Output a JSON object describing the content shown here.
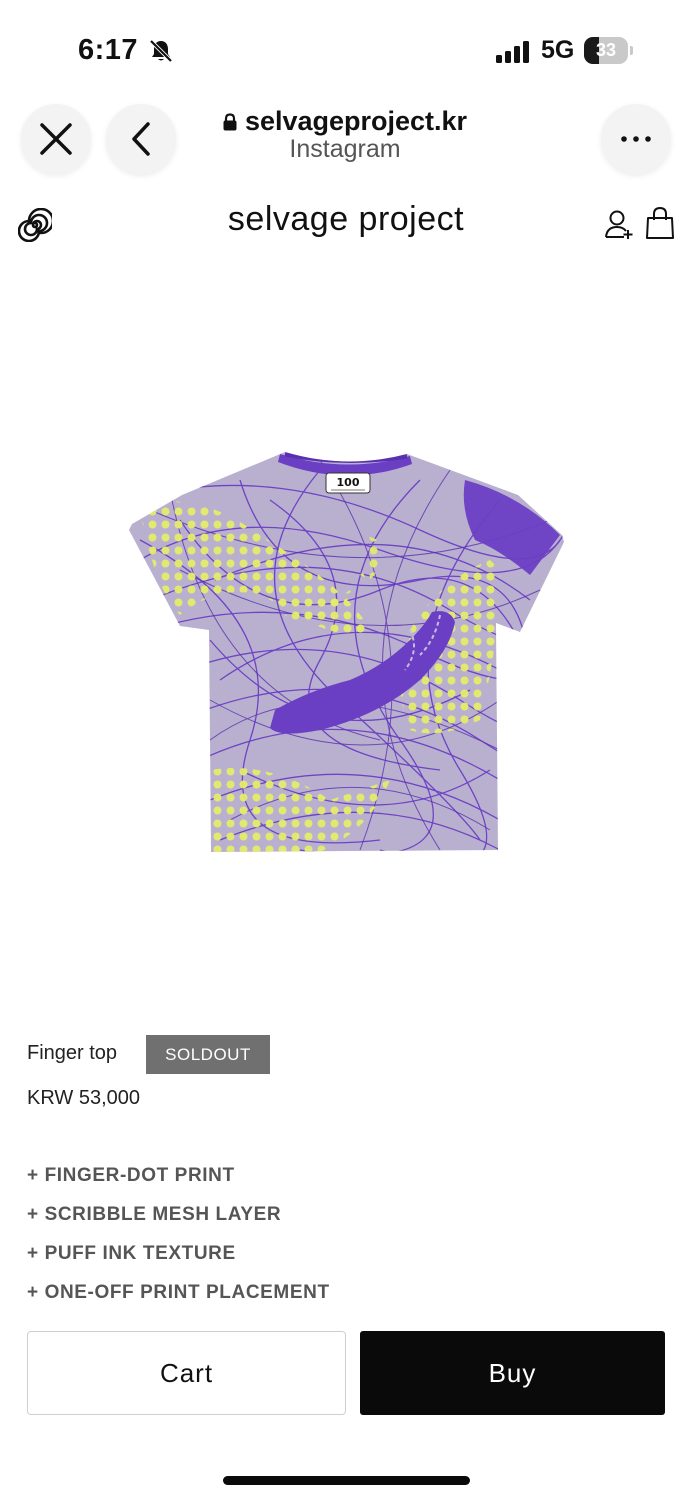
{
  "status_bar": {
    "time": "6:17",
    "network": "5G",
    "battery_percent": "33",
    "battery_level": 0.33
  },
  "browser": {
    "url": "selvageproject.kr",
    "source_app": "Instagram",
    "icons": {
      "close": "close-icon",
      "back": "chevron-left-icon",
      "more": "more-icon",
      "lock": "lock-icon"
    }
  },
  "site_header": {
    "brand": "selvage project",
    "icons": {
      "logo": "spiral-logo-icon",
      "account": "account-add-icon",
      "bag": "shopping-bag-icon"
    }
  },
  "product": {
    "name": "Finger top",
    "badge": "SOLDOUT",
    "price": "KRW 53,000",
    "label_text": "100",
    "features": [
      "+ FINGER-DOT PRINT",
      "+ SCRIBBLE MESH LAYER",
      "+ PUFF INK TEXTURE",
      "+ ONE-OFF PRINT PLACEMENT"
    ],
    "colors": {
      "base": "#6a3fc4",
      "scribble": "#5a30b0",
      "dots": "#e4ec6a",
      "mesh": "#b9b0cf"
    }
  },
  "actions": {
    "cart_label": "Cart",
    "buy_label": "Buy"
  }
}
